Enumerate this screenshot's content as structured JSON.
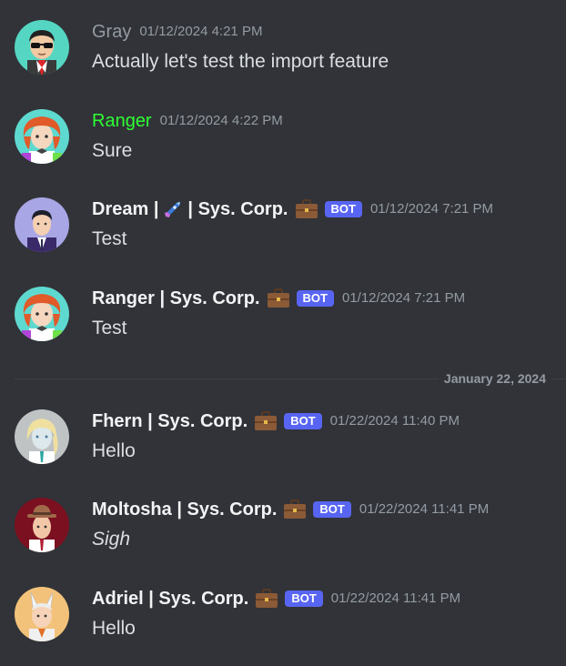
{
  "messages": [
    {
      "username": "Gray",
      "timestamp": "01/12/2024 4:21 PM",
      "content": "Actually let's test the import feature",
      "name_style": "gray",
      "avatar": "sunglasses-man-avatar"
    },
    {
      "username": "Ranger",
      "timestamp": "01/12/2024 4:22 PM",
      "content": "Sure",
      "name_style": "green",
      "avatar": "red-hair-character-avatar"
    },
    {
      "username_prefix": "Dream |",
      "username_suffix": "| Sys. Corp.",
      "name_emoji": "rocket",
      "badge_emoji": "briefcase",
      "bot_tag": "BOT",
      "timestamp": "01/12/2024 7:21 PM",
      "content": "Test",
      "avatar": "suit-man-avatar"
    },
    {
      "username": "Ranger | Sys. Corp.",
      "badge_emoji": "briefcase",
      "bot_tag": "BOT",
      "timestamp": "01/12/2024 7:21 PM",
      "content": "Test",
      "avatar": "red-hair-character-avatar"
    },
    {
      "username": "Fhern | Sys. Corp.",
      "badge_emoji": "briefcase",
      "bot_tag": "BOT",
      "timestamp": "01/22/2024 11:40 PM",
      "content": "Hello",
      "avatar": "blonde-character-avatar"
    },
    {
      "username": "Moltosha | Sys. Corp.",
      "badge_emoji": "briefcase",
      "bot_tag": "BOT",
      "timestamp": "01/22/2024 11:41 PM",
      "content": "Sigh",
      "content_style": "italic",
      "avatar": "fedora-character-avatar"
    },
    {
      "username": "Adriel | Sys. Corp.",
      "badge_emoji": "briefcase",
      "bot_tag": "BOT",
      "timestamp": "01/22/2024 11:41 PM",
      "content": "Hello",
      "avatar": "horned-character-avatar"
    }
  ],
  "date_divider": "January 22, 2024",
  "colors": {
    "background": "#313338",
    "text": "#dbdee1",
    "username": "#f2f3f5",
    "muted": "#949ba4",
    "green_name": "#2dff32",
    "bot_tag": "#5865f2",
    "divider": "#3f4147"
  }
}
